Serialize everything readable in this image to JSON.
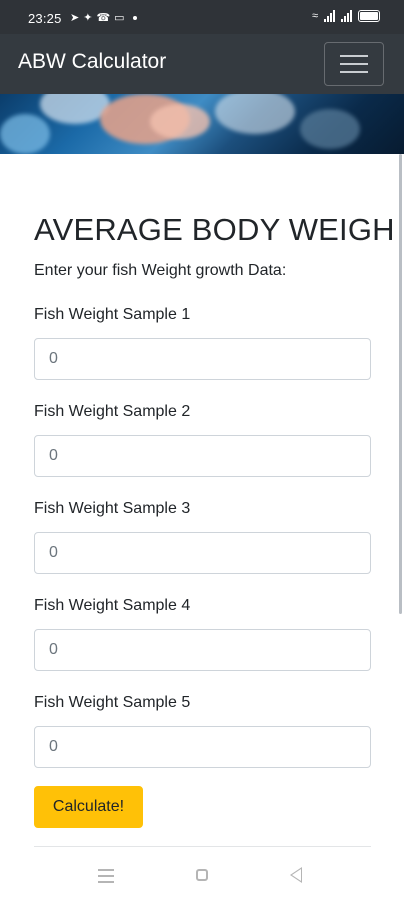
{
  "status_bar": {
    "time": "23:25"
  },
  "navbar": {
    "brand": "ABW Calculator"
  },
  "page": {
    "title": "AVERAGE BODY WEIGH",
    "subtitle": "Enter your fish Weight growth Data:"
  },
  "fields": [
    {
      "label": "Fish Weight Sample 1",
      "placeholder": "0"
    },
    {
      "label": "Fish Weight Sample 2",
      "placeholder": "0"
    },
    {
      "label": "Fish Weight Sample 3",
      "placeholder": "0"
    },
    {
      "label": "Fish Weight Sample 4",
      "placeholder": "0"
    },
    {
      "label": "Fish Weight Sample 5",
      "placeholder": "0"
    }
  ],
  "calculate_button": {
    "label": "Calculate!"
  },
  "colors": {
    "navbar_bg": "#343a40",
    "button_accent": "#ffc107",
    "input_border": "#ced4da"
  },
  "icons": {
    "status_left": [
      "telegram-icon",
      "twitter-icon",
      "whatsapp-icon",
      "notification-icon"
    ],
    "status_right": [
      "wifi-icon",
      "signal-icon",
      "signal-icon",
      "battery-icon"
    ],
    "navbar": "hamburger-menu-icon",
    "system_nav": [
      "menu-icon",
      "home-icon",
      "back-icon"
    ]
  }
}
